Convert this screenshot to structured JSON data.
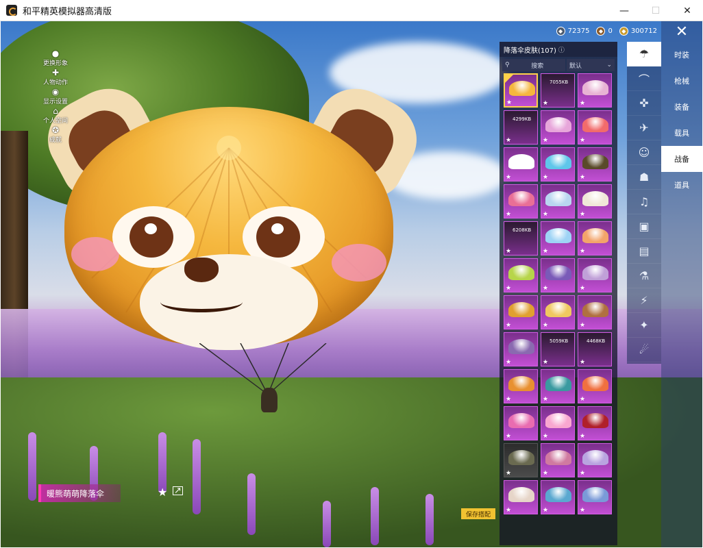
{
  "window": {
    "title": "和平精英模拟器高清版",
    "controls": {
      "minimize": "—",
      "maximize": "☐",
      "close": "✕"
    }
  },
  "side_menu": [
    {
      "label": "更换形象",
      "icon": "person-icon"
    },
    {
      "label": "人物动作",
      "icon": "puzzle-icon"
    },
    {
      "label": "显示设置",
      "icon": "eye-icon"
    },
    {
      "label": "个人空间",
      "icon": "house-icon"
    },
    {
      "label": "成就",
      "icon": "badge-icon"
    }
  ],
  "currencies": [
    {
      "type": "silver",
      "value": "72375"
    },
    {
      "type": "bronze",
      "value": "0"
    },
    {
      "type": "gold",
      "value": "300712"
    }
  ],
  "categories": [
    {
      "label": "时装",
      "active": false
    },
    {
      "label": "枪械",
      "active": false
    },
    {
      "label": "装备",
      "active": false
    },
    {
      "label": "载具",
      "active": false
    },
    {
      "label": "战备",
      "active": true
    },
    {
      "label": "道具",
      "active": false
    }
  ],
  "sub_icons": [
    "parachute-icon",
    "glider-icon",
    "drone-icon",
    "plane-icon",
    "emote-icon",
    "robot-icon",
    "sound-icon",
    "spray-icon",
    "photo-icon",
    "extinguisher-icon",
    "signal-icon",
    "sparkle-icon",
    "ufo-icon"
  ],
  "panel": {
    "title": "降落伞皮肤(107)",
    "search_placeholder": "搜索",
    "sort_label": "默认"
  },
  "items": [
    {
      "c": "#f5b73e",
      "selected": true
    },
    {
      "c": "#3a2a30",
      "dl": "7055KB"
    },
    {
      "c": "#e8b3d4"
    },
    {
      "c": "#1f1f1f",
      "dl": "4299KB"
    },
    {
      "c": "#e7a6da"
    },
    {
      "c": "#f26b6b"
    },
    {
      "c": "#ffffff"
    },
    {
      "c": "#5fc6ea"
    },
    {
      "c": "#5a4a2a"
    },
    {
      "c": "#e96f96"
    },
    {
      "c": "#b9d6f0"
    },
    {
      "c": "#f0e8d8"
    },
    {
      "c": "#555a6a",
      "dl": "6208KB"
    },
    {
      "c": "#9ed3f5"
    },
    {
      "c": "#f3a46a"
    },
    {
      "c": "#b7d54a"
    },
    {
      "c": "#7a5ab8"
    },
    {
      "c": "#c0a0d8"
    },
    {
      "c": "#e0a030"
    },
    {
      "c": "#f0c860"
    },
    {
      "c": "#b07040"
    },
    {
      "c": "#8a6ab0"
    },
    {
      "c": "#2a1a30",
      "dl": "5059KB"
    },
    {
      "c": "#2a1a30",
      "dl": "4468KB"
    },
    {
      "c": "#e89030"
    },
    {
      "c": "#3a9aa0"
    },
    {
      "c": "#f07040"
    },
    {
      "c": "#e96cb0"
    },
    {
      "c": "#f9a7d0"
    },
    {
      "c": "#b0202a"
    },
    {
      "c": "#6a6a50",
      "plain": true
    },
    {
      "c": "#d07aa0"
    },
    {
      "c": "#b9a4e0"
    },
    {
      "c": "#e6d5c8"
    },
    {
      "c": "#5aa8d0"
    },
    {
      "c": "#7a9ad8"
    }
  ],
  "selected_item": {
    "name": "暖熊萌萌降落伞",
    "save_label": "保存搭配"
  }
}
